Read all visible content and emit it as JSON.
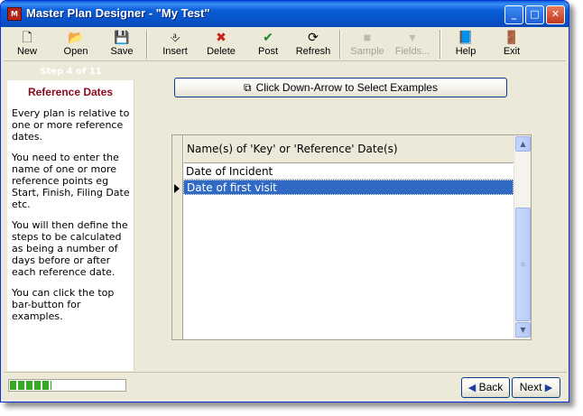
{
  "window": {
    "title": "Master Plan Designer - \"My Test\"",
    "app_icon_glyph": "M",
    "controls": {
      "minimize": "_",
      "maximize": "□",
      "close": "✕"
    }
  },
  "toolbar": {
    "items": [
      {
        "label": "New",
        "icon": "new-document-icon",
        "glyph": "🗋",
        "enabled": true
      },
      {
        "label": "Open",
        "icon": "open-folder-icon",
        "glyph": "📂",
        "enabled": true
      },
      {
        "label": "Save",
        "icon": "floppy-disk-icon",
        "glyph": "💾",
        "enabled": true
      },
      {
        "label": "Insert",
        "icon": "insert-icon",
        "glyph": "⎀",
        "enabled": true
      },
      {
        "label": "Delete",
        "icon": "delete-x-icon",
        "glyph": "✖",
        "enabled": true
      },
      {
        "label": "Post",
        "icon": "checkmark-icon",
        "glyph": "✔",
        "enabled": true
      },
      {
        "label": "Refresh",
        "icon": "refresh-icon",
        "glyph": "⟳",
        "enabled": true
      },
      {
        "label": "Sample",
        "icon": "sample-square-icon",
        "glyph": "■",
        "enabled": false
      },
      {
        "label": "Fields...",
        "icon": "chevron-down-icon",
        "glyph": "▾",
        "enabled": false
      },
      {
        "label": "Help",
        "icon": "help-book-icon",
        "glyph": "📘",
        "enabled": true
      },
      {
        "label": "Exit",
        "icon": "exit-door-icon",
        "glyph": "🚪",
        "enabled": true
      }
    ]
  },
  "sidebar": {
    "step": "Step 4 of 11",
    "title": "Reference Dates",
    "paragraphs": [
      "Every plan is relative to one or more reference dates.",
      "You need to enter the name of one or more reference points eg Start, Finish, Filing Date etc.",
      "You will then define the steps to be calculated as being a number of days before or after each reference date.",
      "You can click the top bar-button for examples."
    ]
  },
  "examples_button": {
    "label": "Click Down-Arrow to Select Examples",
    "icon": "examples-icon"
  },
  "grid": {
    "header": "Name(s) of 'Key' or 'Reference' Date(s)",
    "rows": [
      "Date of Incident",
      "Date of first visit"
    ],
    "selected_row": 1
  },
  "status": {
    "progress_fraction": 0.36
  },
  "nav": {
    "back": "Back",
    "next": "Next"
  },
  "colors": {
    "titlebar": "#0a5fd8",
    "sidebar_title": "#8b0a1e",
    "selection": "#316ac5",
    "progress": "#33aa22"
  }
}
